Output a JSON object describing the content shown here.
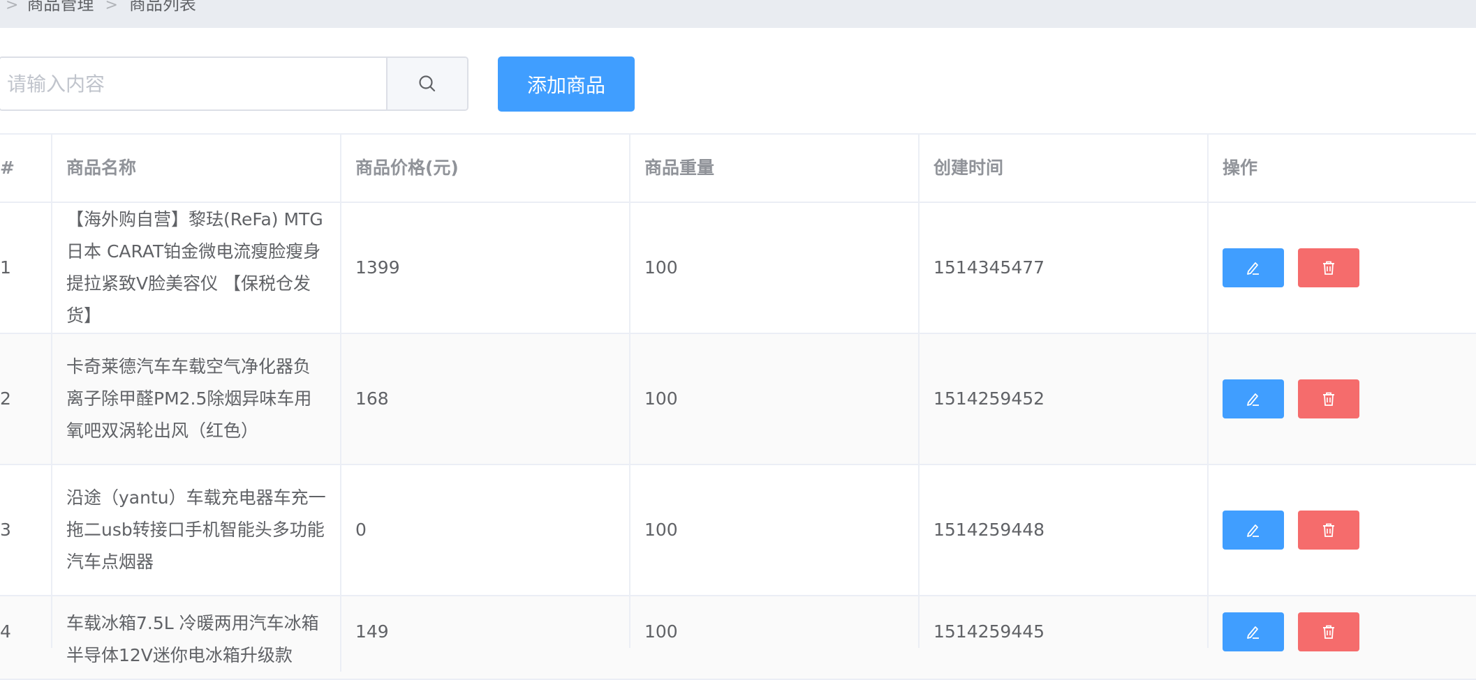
{
  "breadcrumb": {
    "lead_sep": "/",
    "items": [
      "商品管理",
      "商品列表"
    ],
    "sep": ">"
  },
  "search": {
    "placeholder": "请输入内容",
    "value": ""
  },
  "toolbar": {
    "add_label": "添加商品"
  },
  "table": {
    "headers": [
      "#",
      "商品名称",
      "商品价格(元)",
      "商品重量",
      "创建时间",
      "操作"
    ],
    "rows": [
      {
        "index": "1",
        "name": "【海外购自营】黎珐(ReFa) MTG日本 CARAT铂金微电流瘦脸瘦身提拉紧致V脸美容仪 【保税仓发货】",
        "price": "1399",
        "weight": "100",
        "created": "1514345477"
      },
      {
        "index": "2",
        "name": "卡奇莱德汽车车载空气净化器负离子除甲醛PM2.5除烟异味车用氧吧双涡轮出风（红色）",
        "price": "168",
        "weight": "100",
        "created": "1514259452"
      },
      {
        "index": "3",
        "name": "沿途（yantu）车载充电器车充一拖二usb转接口手机智能头多功能汽车点烟器",
        "price": "0",
        "weight": "100",
        "created": "1514259448"
      },
      {
        "index": "4",
        "name": "车载冰箱7.5L 冷暖两用汽车冰箱半导体12V迷你电冰箱升级款",
        "price": "149",
        "weight": "100",
        "created": "1514259445"
      }
    ]
  },
  "icons": {
    "search": "search-icon",
    "edit": "edit-icon",
    "delete": "trash-icon"
  },
  "colors": {
    "primary": "#409eff",
    "danger": "#f56c6c",
    "topbar": "#e9ecf1"
  }
}
